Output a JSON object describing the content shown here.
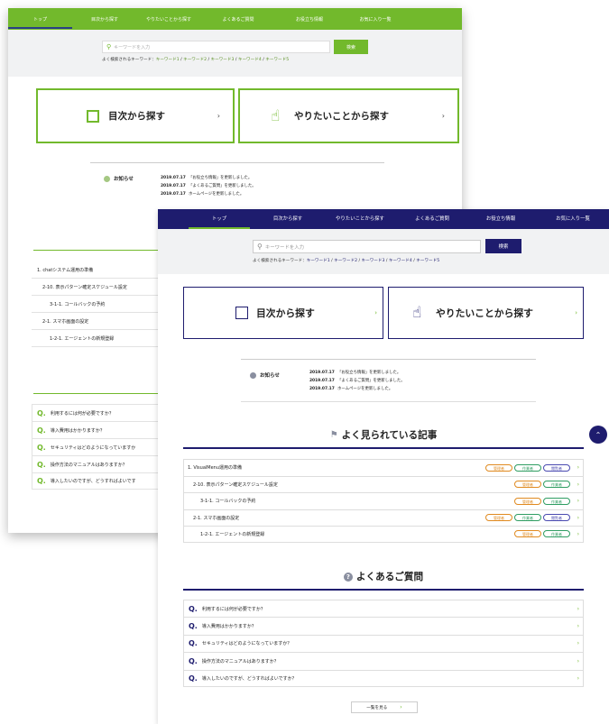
{
  "colors": {
    "green_accent": "#72b92c",
    "navy_accent": "#1e1c6e"
  },
  "back": {
    "nav": [
      "トップ",
      "目次から探す",
      "やりたいことから探す",
      "よくあるご質問",
      "お役立ち情報",
      "お気に入り一覧"
    ],
    "search": {
      "placeholder": "キーワードを入力",
      "button": "検索",
      "popular_label": "よく検索されるキーワード：",
      "keywords": [
        "キーワード1",
        "キーワード2",
        "キーワード3",
        "キーワード4",
        "キーワード5"
      ]
    },
    "big_buttons": [
      "目次から探す",
      "やりたいことから探す"
    ],
    "news": {
      "title": "お知らせ",
      "rows": [
        {
          "date": "2019.07.17",
          "text": "「お役立ち情報」を更新しました。"
        },
        {
          "date": "2019.07.17",
          "text": "「よくあるご質問」を更新しました。"
        },
        {
          "date": "2019.07.17",
          "text": "ホームページを更新しました。"
        }
      ]
    },
    "articles": [
      "1. chatシステム運用の準備",
      "2-10. 表示パターン確定スケジュール設定",
      "3-1-1. コールバックの予約",
      "2-1. スマホ画面の設定",
      "1-2-1. エージェントの新規登録"
    ],
    "faq": [
      "利用するには何が必要ですか？",
      "導入費用はかかりますか？",
      "セキュリティはどのようになっていますか",
      "操作方法のマニュアルはありますか？",
      "導入したいのですが、どうすればよいです"
    ]
  },
  "front": {
    "nav": [
      "トップ",
      "目次から探す",
      "やりたいことから探す",
      "よくあるご質問",
      "お役立ち情報",
      "お気に入り一覧"
    ],
    "search": {
      "placeholder": "キーワードを入力",
      "button": "検索",
      "popular_label": "よく検索されるキーワード：",
      "keywords": [
        "キーワード1",
        "キーワード2",
        "キーワード3",
        "キーワード4",
        "キーワード5"
      ]
    },
    "big_buttons": [
      "目次から探す",
      "やりたいことから探す"
    ],
    "news": {
      "title": "お知らせ",
      "rows": [
        {
          "date": "2019.07.17",
          "text": "「お役立ち情報」を更新しました。"
        },
        {
          "date": "2019.07.17",
          "text": "「よくあるご質問」を更新しました。"
        },
        {
          "date": "2019.07.17",
          "text": "ホームページを更新しました。"
        }
      ]
    },
    "popular_title": "よく見られている記事",
    "articles": [
      {
        "title": "1. VisualMenu運用の準備",
        "badges": [
          "管理者",
          "作業者",
          "閲覧者"
        ]
      },
      {
        "title": "2-10. 表示パターン確定スケジュール設定",
        "badges": [
          "管理者",
          "作業者"
        ]
      },
      {
        "title": "3-1-1. コールバックの予約",
        "badges": [
          "管理者",
          "作業者"
        ]
      },
      {
        "title": "2-1. スマホ画面の設定",
        "badges": [
          "管理者",
          "作業者",
          "閲覧者"
        ]
      },
      {
        "title": "1-2-1. エージェントの新規登録",
        "badges": [
          "管理者",
          "作業者"
        ]
      }
    ],
    "faq_title": "よくあるご質問",
    "faq": [
      "利用するには何が必要ですか？",
      "導入費用はかかりますか？",
      "セキュリティはどのようになっていますか？",
      "操作方法のマニュアルはありますか？",
      "導入したいのですが、どうすればよいですか？"
    ],
    "more_button": "一覧を見る"
  }
}
